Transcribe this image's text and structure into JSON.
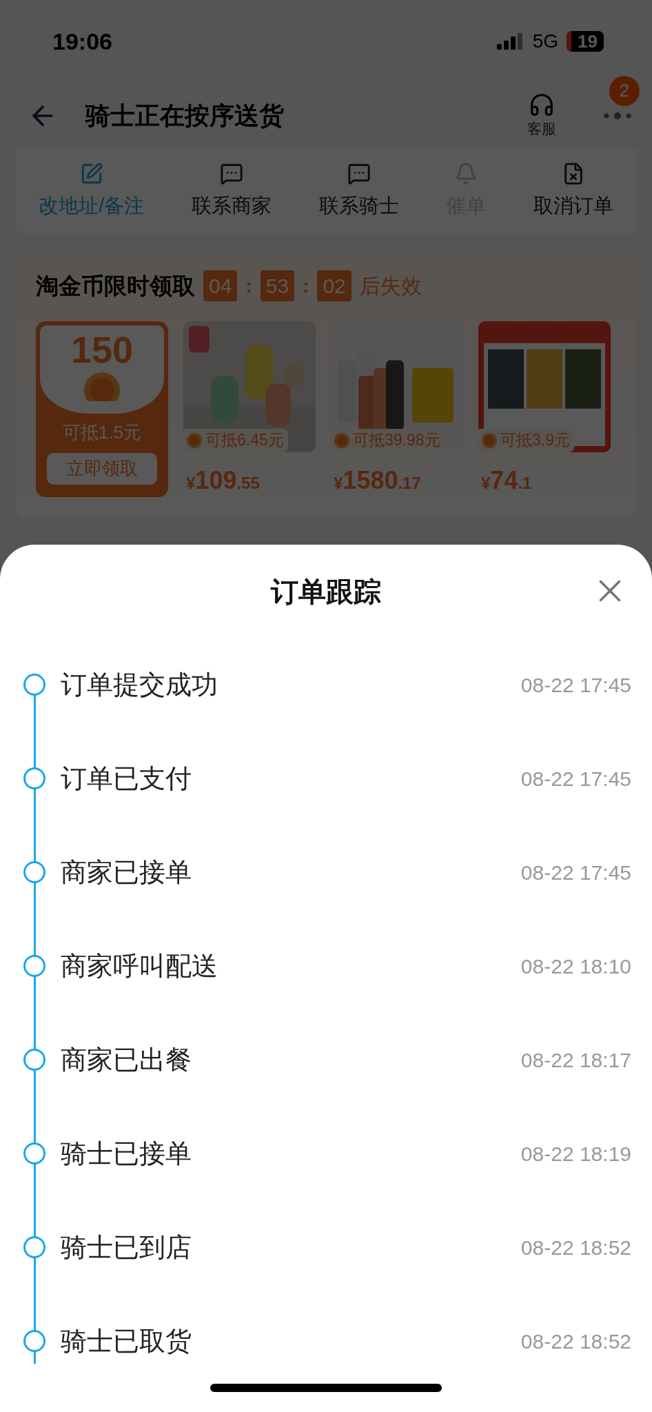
{
  "status_bar": {
    "time": "19:06",
    "network": "5G",
    "battery": "19"
  },
  "header": {
    "title": "骑士正在按序送货",
    "service_label": "客服",
    "badge": "2"
  },
  "actions": [
    {
      "kind": "edit",
      "label": "改地址/备注",
      "highlighted": true,
      "disabled": false
    },
    {
      "kind": "chat",
      "label": "联系商家",
      "highlighted": false,
      "disabled": false
    },
    {
      "kind": "chat",
      "label": "联系骑士",
      "highlighted": false,
      "disabled": false
    },
    {
      "kind": "bell",
      "label": "催单",
      "highlighted": false,
      "disabled": true
    },
    {
      "kind": "cancel",
      "label": "取消订单",
      "highlighted": false,
      "disabled": false
    }
  ],
  "promo": {
    "title": "淘金币限时领取",
    "countdown": [
      "04",
      "53",
      "02"
    ],
    "separator": ":",
    "suffix": "后失效",
    "coupon": {
      "amount": "150",
      "note": "可抵1.5元",
      "button": "立即领取"
    },
    "products": [
      {
        "deduct": "可抵6.45元",
        "currency": "¥",
        "price": "109",
        "decimals": ".55"
      },
      {
        "deduct": "可抵39.98元",
        "currency": "¥",
        "price": "1580",
        "decimals": ".17"
      },
      {
        "deduct": "可抵3.9元",
        "currency": "¥",
        "price": "74",
        "decimals": ".1"
      }
    ]
  },
  "sheet": {
    "title": "订单跟踪",
    "events": [
      {
        "label": "订单提交成功",
        "time": "08-22 17:45"
      },
      {
        "label": "订单已支付",
        "time": "08-22 17:45"
      },
      {
        "label": "商家已接单",
        "time": "08-22 17:45"
      },
      {
        "label": "商家呼叫配送",
        "time": "08-22 18:10"
      },
      {
        "label": "商家已出餐",
        "time": "08-22 18:17"
      },
      {
        "label": "骑士已接单",
        "time": "08-22 18:19"
      },
      {
        "label": "骑士已到店",
        "time": "08-22 18:52"
      },
      {
        "label": "骑士已取货",
        "time": "08-22 18:52"
      }
    ]
  }
}
